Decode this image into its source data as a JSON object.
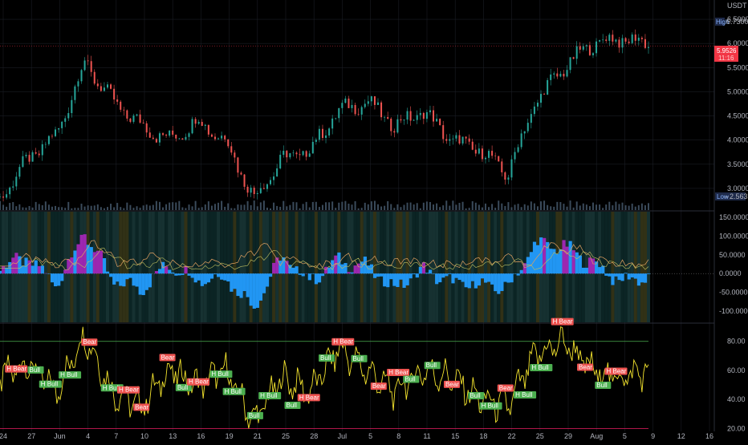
{
  "currency": "USDT",
  "colors": {
    "background": "#000000",
    "grid": "#1a1d24",
    "candle_up": "#26a69a",
    "candle_down": "#ef5350",
    "osc_positive": "#2196f3",
    "osc_negative": "#9c27b0",
    "rsi_line": "#f5e52e",
    "upper_band": "#4caf50",
    "lower_band": "#e91e63",
    "bull_label": "#4caf50",
    "bear_label": "#ef5350",
    "price_tag": "#f23645",
    "extreme_tag": "#1e2a4a"
  },
  "price_panel": {
    "high_label": "High",
    "high_value": "6.7300",
    "low_label": "Low",
    "low_value": "2.5637",
    "last_price": "5.9526",
    "last_time": "11:16",
    "ticks": [
      "6.5000",
      "6.0000",
      "5.5000",
      "5.0000",
      "4.5000",
      "4.0000",
      "3.5000",
      "3.0000"
    ],
    "ylim": [
      2.55,
      6.9
    ]
  },
  "osc_panel": {
    "ticks": [
      "150.0000",
      "100.0000",
      "50.0000",
      "0.0000",
      "-50.0000",
      "-100.0000"
    ],
    "ylim": [
      -130,
      165
    ]
  },
  "rsi_panel": {
    "ticks": [
      "80.00",
      "60.00",
      "40.00",
      "20.00"
    ],
    "ylim": [
      18,
      92
    ],
    "upper": 80,
    "lower": 20,
    "bull_text": "Bull",
    "hbull_text": "H Bull",
    "bear_text": "Bear",
    "hbear_text": "H Bear"
  },
  "x_axis": [
    "24",
    "27",
    "Jun",
    "4",
    "7",
    "10",
    "13",
    "16",
    "19",
    "21",
    "25",
    "28",
    "Jul",
    "5",
    "8",
    "11",
    "15",
    "18",
    "22",
    "25",
    "29",
    "Aug",
    "5",
    "9",
    "12",
    "16"
  ],
  "chart_data": [
    {
      "type": "line",
      "panel": "price",
      "x": [
        "May 24",
        "May 27",
        "Jun 1",
        "Jun 4",
        "Jun 7",
        "Jun 10",
        "Jun 13",
        "Jun 16",
        "Jun 19",
        "Jun 21",
        "Jun 25",
        "Jun 28",
        "Jul 1",
        "Jul 5",
        "Jul 8",
        "Jul 11",
        "Jul 15",
        "Jul 18",
        "Jul 22",
        "Jul 25",
        "Jul 29",
        "Aug 1",
        "Aug 5",
        "Aug 9"
      ],
      "series": [
        {
          "values": [
            2.8,
            3.6,
            4.1,
            5.6,
            4.8,
            4.3,
            4.0,
            4.4,
            4.0,
            2.8,
            3.6,
            3.8,
            4.6,
            4.8,
            4.3,
            4.6,
            4.0,
            3.8,
            3.3,
            4.8,
            5.5,
            6.0,
            6.1,
            6.0
          ]
        }
      ],
      "ylim": [
        2.55,
        6.9
      ]
    },
    {
      "type": "area",
      "panel": "oscillator",
      "x": [
        "May 24",
        "May 27",
        "Jun 1",
        "Jun 4",
        "Jun 7",
        "Jun 10",
        "Jun 13",
        "Jun 16",
        "Jun 19",
        "Jun 21",
        "Jun 25",
        "Jun 28",
        "Jul 1",
        "Jul 5",
        "Jul 8",
        "Jul 11",
        "Jul 15",
        "Jul 18",
        "Jul 22",
        "Jul 25",
        "Jul 29",
        "Aug 1",
        "Aug 5",
        "Aug 9"
      ],
      "series": [
        {
          "values": [
            20,
            40,
            -30,
            110,
            -20,
            -40,
            25,
            -15,
            -10,
            -90,
            45,
            -20,
            35,
            20,
            -40,
            10,
            -25,
            -30,
            -40,
            80,
            70,
            30,
            -20,
            -10
          ]
        }
      ],
      "ylim": [
        -130,
        165
      ]
    },
    {
      "type": "line",
      "panel": "rsi",
      "x": [
        "May 24",
        "May 27",
        "Jun 1",
        "Jun 4",
        "Jun 7",
        "Jun 10",
        "Jun 13",
        "Jun 16",
        "Jun 19",
        "Jun 21",
        "Jun 25",
        "Jun 28",
        "Jul 1",
        "Jul 5",
        "Jul 8",
        "Jul 11",
        "Jul 15",
        "Jul 18",
        "Jul 22",
        "Jul 25",
        "Jul 29",
        "Aug 1",
        "Aug 5",
        "Aug 9"
      ],
      "series": [
        {
          "values": [
            55,
            65,
            45,
            85,
            45,
            35,
            60,
            50,
            60,
            25,
            55,
            45,
            75,
            60,
            45,
            60,
            55,
            40,
            35,
            70,
            80,
            60,
            55,
            60
          ]
        }
      ],
      "ylim": [
        18,
        92
      ]
    }
  ]
}
